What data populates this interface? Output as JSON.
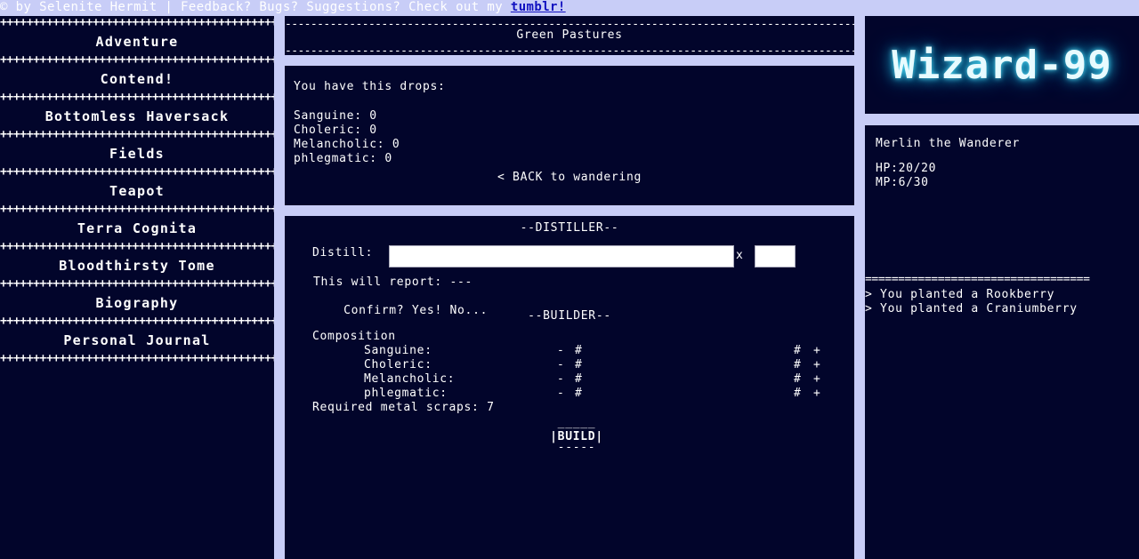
{
  "topbar": {
    "credit": "© by Selenite Hermit | Feedback? Bugs? Suggestions? Check out my ",
    "link_label": "tumblr!"
  },
  "nav": {
    "items": [
      {
        "label": "Adventure"
      },
      {
        "label": "Contend!"
      },
      {
        "label": "Bottomless Haversack"
      },
      {
        "label": "Fields"
      },
      {
        "label": "Teapot"
      },
      {
        "label": "Terra Cognita"
      },
      {
        "label": "Bloodthirsty Tome"
      },
      {
        "label": "Biography"
      },
      {
        "label": "Personal Journal"
      }
    ]
  },
  "location": {
    "title": "Green Pastures"
  },
  "drops": {
    "intro": "You have this drops:",
    "items": [
      {
        "label": "Sanguine: 0"
      },
      {
        "label": "Choleric: 0"
      },
      {
        "label": "Melancholic: 0"
      },
      {
        "label": "phlegmatic: 0"
      }
    ],
    "back_link": "< BACK to wandering"
  },
  "distiller": {
    "heading": "--DISTILLER--",
    "distill_label": "Distill:",
    "distill_value": "",
    "times": "x",
    "qty_value": "",
    "report": "This will report: ---",
    "confirm_label": "Confirm?",
    "yes": "Yes!",
    "no": "No..."
  },
  "builder": {
    "heading": "--BUILDER--",
    "composition_label": "Composition",
    "rows": [
      {
        "label": "Sanguine:"
      },
      {
        "label": "Choleric:"
      },
      {
        "label": "Melancholic:"
      },
      {
        "label": "phlegmatic:"
      }
    ],
    "minus": "-",
    "hash": "#",
    "plus": "+",
    "required": "Required metal scraps: 7",
    "build_top": "_____",
    "build_label": "|BUILD|",
    "build_bottom": "-----"
  },
  "logo": {
    "text": "Wizard-99"
  },
  "character": {
    "name": "Merlin the Wanderer",
    "hp": "HP:20/20",
    "mp": "MP:6/30"
  },
  "log": {
    "separator": "==================================",
    "entries": [
      {
        "text": "> You planted a Rookberry"
      },
      {
        "text": "> You planted a Craniumberry"
      }
    ]
  },
  "colors": {
    "background": "#c8cdf7",
    "panel": "#02052b",
    "text": "#ffffff",
    "link": "#1010c0",
    "logo_glow": "#4fd6f0"
  }
}
